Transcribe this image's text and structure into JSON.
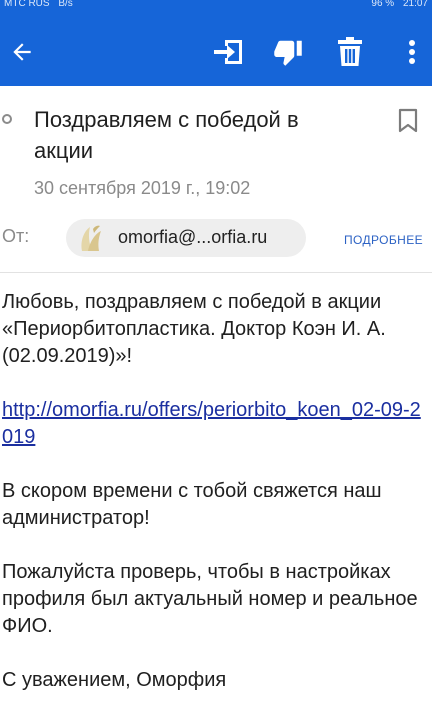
{
  "statusbar": {
    "left": [
      "МТС RUS",
      "B/s"
    ],
    "right": [
      "96 %",
      "21:07"
    ]
  },
  "toolbar": {
    "back": "arrow-left-icon",
    "move": "move-to-folder-icon",
    "spam": "thumb-down-icon",
    "delete": "trash-icon",
    "more": "more-vertical-icon"
  },
  "message": {
    "subject": "Поздравляем с победой в акции",
    "date": "30 сентября 2019 г., 19:02",
    "from_label": "От:",
    "sender_email": "omorfia@...orfia.ru",
    "details_label": "ПОДРОБНЕЕ",
    "paragraphs": [
      "Любовь, поздравляем с победой в акции «Периорбитопластика. Доктор Коэн И. А. (02.09.2019)»!",
      "В скором времени с тобой свяжется наш администратор!",
      "Пожалуйста проверь, чтобы в настройках профиля был актуальный номер и реальное ФИО.",
      "С уважением, Оморфия"
    ],
    "link": "http://omorfia.ru/offers/periorbito_koen_02-09-2019"
  },
  "colors": {
    "accent": "#1665d8",
    "link": "#1b2fa0",
    "details": "#2c62c4"
  }
}
